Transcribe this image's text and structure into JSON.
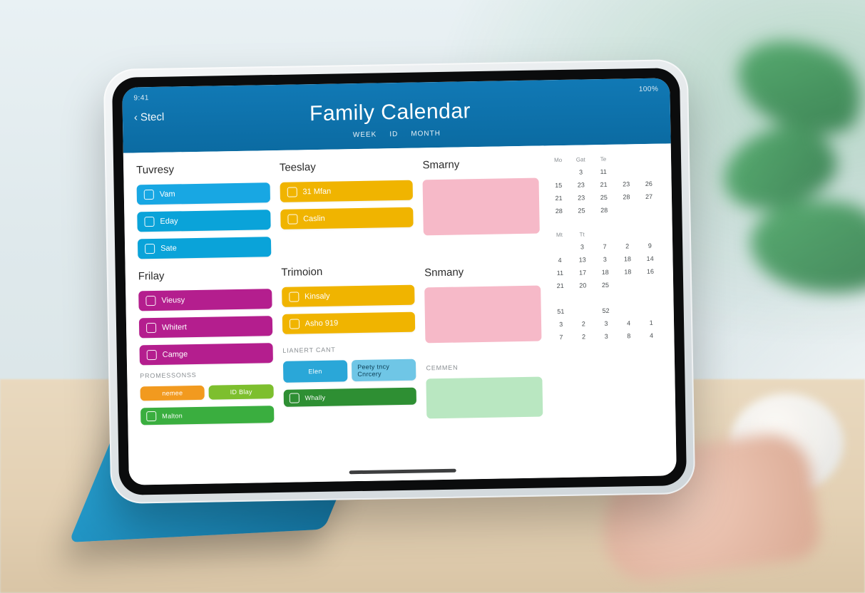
{
  "status": {
    "left": "9:41",
    "right": "100%"
  },
  "nav": {
    "back": "Stecl"
  },
  "title": "Family Calendar",
  "tabs": [
    "WEEK",
    "ID",
    "MONTH"
  ],
  "col1": {
    "day_a": "Tuvresy",
    "a_items": [
      {
        "label": "Vam"
      },
      {
        "label": "Eday"
      },
      {
        "label": "Sate"
      }
    ],
    "day_b": "Frilay",
    "b_items": [
      {
        "label": "Vieusy"
      },
      {
        "label": "Whitert"
      },
      {
        "label": "Camge"
      }
    ],
    "foot": "Promessonss",
    "foot_items": [
      {
        "label": "nemee"
      },
      {
        "label": "ID Blay"
      },
      {
        "label": "Malton"
      }
    ]
  },
  "col2": {
    "day_a": "Teeslay",
    "a_items": [
      {
        "label": "31  Mfan"
      },
      {
        "label": "Caslin"
      }
    ],
    "day_b": "Trimoion",
    "b_items": [
      {
        "label": "Kinsaly"
      },
      {
        "label": "Asho 919"
      }
    ],
    "foot": "Lianert Cant",
    "foot_items": [
      {
        "label": "Elen"
      },
      {
        "label": "Whally"
      }
    ],
    "foot_items_b": [
      {
        "label": "Peety tncy Cnrcery"
      }
    ]
  },
  "col3": {
    "day_a": "Smarny",
    "day_b": "Snmany",
    "foot": "Cemmen"
  },
  "mini1": {
    "head": [
      "Mo",
      "Gat",
      "Te",
      "",
      ""
    ],
    "rows": [
      [
        "",
        "3",
        "11",
        "",
        ""
      ],
      [
        "15",
        "23",
        "21",
        "23",
        "26"
      ],
      [
        "21",
        "23",
        "25",
        "28",
        "27"
      ],
      [
        "28",
        "25",
        "28",
        "",
        ""
      ]
    ]
  },
  "mini2": {
    "head": [
      "Mt",
      "Tt",
      "",
      "",
      ""
    ],
    "rows": [
      [
        "",
        "3",
        "7",
        "2",
        "9"
      ],
      [
        "4",
        "13",
        "3",
        "18",
        "14"
      ],
      [
        "11",
        "17",
        "18",
        "18",
        "16"
      ],
      [
        "21",
        "20",
        "25",
        "",
        ""
      ]
    ]
  },
  "mini3": {
    "label": "",
    "rows": [
      [
        "51",
        "",
        "52",
        "",
        ""
      ],
      [
        "3",
        "2",
        "3",
        "4",
        "1"
      ],
      [
        "7",
        "2",
        "3",
        "8",
        "4"
      ]
    ]
  }
}
